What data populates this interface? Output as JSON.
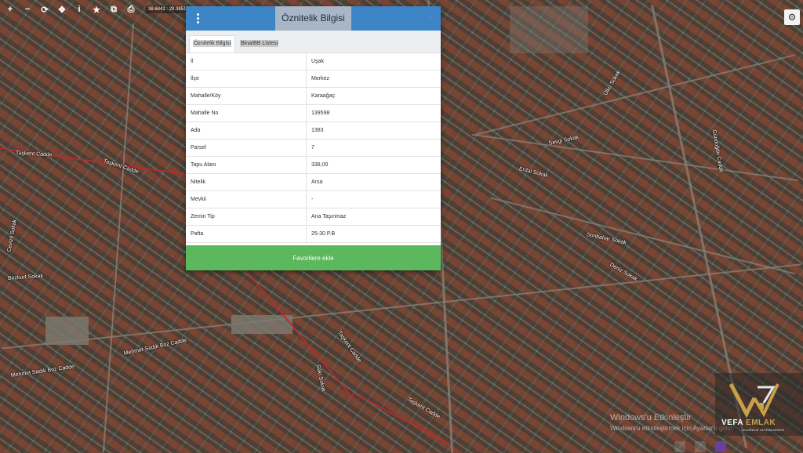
{
  "toolbar": {
    "buttons": [
      {
        "name": "zoom-in",
        "glyph": "+"
      },
      {
        "name": "zoom-out",
        "glyph": "−"
      },
      {
        "name": "refresh",
        "glyph": "⟳"
      },
      {
        "name": "locate",
        "glyph": "✥"
      },
      {
        "name": "info",
        "glyph": "i"
      },
      {
        "name": "favorite",
        "glyph": "★"
      },
      {
        "name": "layers",
        "glyph": "⧉"
      },
      {
        "name": "print",
        "glyph": "⎙"
      }
    ],
    "coordinates": "38.6841 : 29.3851"
  },
  "settings_icon": "gear-icon",
  "panel": {
    "title": "Öznitelik Bilgisi",
    "close_glyph": "×",
    "tabs": [
      {
        "label": "Öznitelik Bilgisi",
        "active": true
      },
      {
        "label": "Bina/BB Listesi",
        "active": false
      }
    ],
    "rows": [
      {
        "key": "İl",
        "value": "Uşak"
      },
      {
        "key": "İlçe",
        "value": "Merkez"
      },
      {
        "key": "Mahalle/Köy",
        "value": "Karaağaç"
      },
      {
        "key": "Mahalle No",
        "value": "139598"
      },
      {
        "key": "Ada",
        "value": "1383"
      },
      {
        "key": "Parsel",
        "value": "7"
      },
      {
        "key": "Tapu Alanı",
        "value": "338,00"
      },
      {
        "key": "Nitelik",
        "value": "Arsa"
      },
      {
        "key": "Mevkii",
        "value": "-"
      },
      {
        "key": "Zemin Tip",
        "value": "Ana Taşınmaz"
      },
      {
        "key": "Pafta",
        "value": "25-30 P.B"
      }
    ],
    "favorite_button": "Favorilere ekle",
    "colors": {
      "header": "#3d85c6",
      "favorite": "#5cb85c"
    }
  },
  "map": {
    "street_labels": [
      "Taşkent Cadde",
      "Taşkent Cadde",
      "Mehmet Sadık Boz Cadde",
      "Mehmet Sadık Boz Cadde",
      "Bozkurt Sokak",
      "Cevizli Sokak",
      "Taşkent Cadde",
      "Saki Sokak",
      "Taşkent Cadde",
      "Sevgi Sokak",
      "Erdal Sokak",
      "Sonbahar Sokak",
      "Deniz Sokak",
      "Gündoğdu Cadde",
      "Ülkü Sokak"
    ]
  },
  "watermark": {
    "line1": "Windows'u Etkinleştir",
    "line2": "Windows'u etkinleştirmek için Ayarlar'a gidin."
  },
  "logo": {
    "brand_first": "VEFA",
    "brand_second": "EMLAK",
    "tagline": "GÜVENİLİR YATIRIM ADRESİ"
  }
}
